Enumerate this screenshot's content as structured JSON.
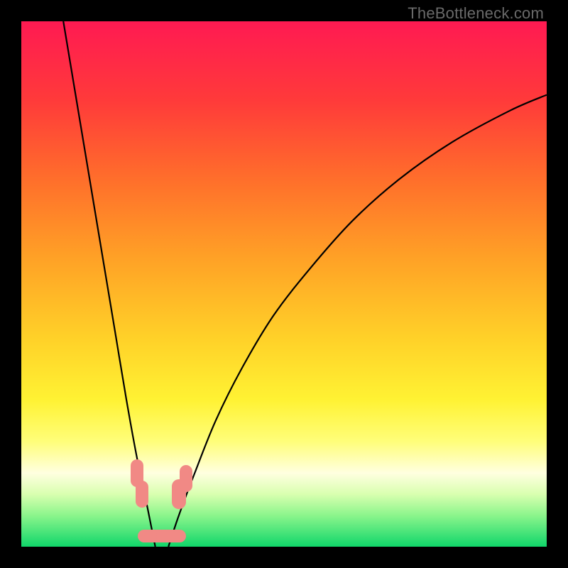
{
  "watermark": "TheBottleneck.com",
  "chart_data": {
    "type": "line",
    "title": "",
    "xlabel": "",
    "ylabel": "",
    "xlim": [
      0,
      100
    ],
    "ylim": [
      0,
      100
    ],
    "grid": false,
    "legend": false,
    "background_gradient": {
      "stops": [
        {
          "pos": 0.0,
          "color": "#ff1a52"
        },
        {
          "pos": 0.15,
          "color": "#ff3a3a"
        },
        {
          "pos": 0.3,
          "color": "#ff6e2b"
        },
        {
          "pos": 0.45,
          "color": "#ffa126"
        },
        {
          "pos": 0.6,
          "color": "#ffd028"
        },
        {
          "pos": 0.72,
          "color": "#fff233"
        },
        {
          "pos": 0.8,
          "color": "#fffe7a"
        },
        {
          "pos": 0.86,
          "color": "#ffffe0"
        },
        {
          "pos": 0.9,
          "color": "#d9ffb0"
        },
        {
          "pos": 0.94,
          "color": "#8cf58c"
        },
        {
          "pos": 1.0,
          "color": "#10d66a"
        }
      ]
    },
    "series": [
      {
        "name": "curve-left",
        "color": "#000000",
        "x": [
          8,
          10,
          12,
          14,
          16,
          18,
          20,
          22,
          23.5,
          24.7,
          25.5
        ],
        "y": [
          100,
          88,
          76,
          64,
          52,
          40,
          28,
          17,
          10,
          4,
          0
        ]
      },
      {
        "name": "curve-right",
        "color": "#000000",
        "x": [
          28,
          30,
          33,
          37,
          42,
          48,
          55,
          63,
          72,
          82,
          93,
          100
        ],
        "y": [
          0,
          6,
          14,
          24,
          34,
          44,
          53,
          62,
          70,
          77,
          83,
          86
        ]
      }
    ],
    "annotations_points": [
      {
        "cluster": "left-A",
        "cx": 22.0,
        "cy": 14.0,
        "rx": 1.2,
        "ry": 2.6
      },
      {
        "cluster": "left-B",
        "cx": 23.0,
        "cy": 10.0,
        "rx": 1.2,
        "ry": 2.6
      },
      {
        "cluster": "right-A",
        "cx": 30.0,
        "cy": 10.0,
        "rx": 1.3,
        "ry": 2.8
      },
      {
        "cluster": "right-B",
        "cx": 31.4,
        "cy": 13.0,
        "rx": 1.2,
        "ry": 2.6
      },
      {
        "cluster": "bottom-A",
        "cx": 25.0,
        "cy": 2.0,
        "rx": 2.8,
        "ry": 1.2
      },
      {
        "cluster": "bottom-B",
        "cx": 28.5,
        "cy": 2.0,
        "rx": 2.8,
        "ry": 1.2
      }
    ]
  }
}
